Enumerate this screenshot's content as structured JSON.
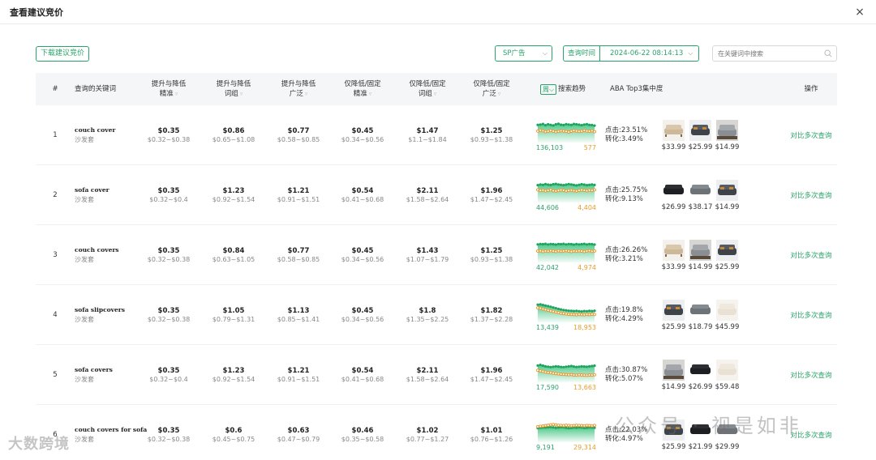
{
  "modal": {
    "title": "查看建议竞价",
    "close_glyph": "×"
  },
  "toolbar": {
    "download_label": "下载建议竞价",
    "ad_type": "SP广告",
    "query_time_label": "查询时间",
    "query_time_value": "2024-06-22 08:14:13",
    "search_placeholder": "在关键词中搜索"
  },
  "columns": {
    "index": "#",
    "keyword": "查询的关键词",
    "c1a": "提升与降低",
    "c1b": "精准",
    "c2a": "提升与降低",
    "c2b": "词组",
    "c3a": "提升与降低",
    "c3b": "广泛",
    "c4a": "仅降低/固定",
    "c4b": "精准",
    "c5a": "仅降低/固定",
    "c5b": "词组",
    "c6a": "仅降低/固定",
    "c6b": "广泛",
    "period": "周",
    "trend": "搜索趋势",
    "aba": "ABA Top3集中度",
    "action": "操作"
  },
  "rows": [
    {
      "idx": "1",
      "kw_en": "couch cover",
      "kw_cn": "沙发套",
      "bids": [
        [
          "$0.35",
          "$0.32~$0.38"
        ],
        [
          "$0.86",
          "$0.65~$1.08"
        ],
        [
          "$0.77",
          "$0.58~$0.85"
        ],
        [
          "$0.45",
          "$0.34~$0.56"
        ],
        [
          "$1.47",
          "$1.1~$1.84"
        ],
        [
          "$1.25",
          "$0.93~$1.38"
        ]
      ],
      "trend_left": "136,103",
      "trend_right": "577",
      "trend_green": [
        0.9,
        0.92,
        0.95,
        0.88,
        0.93,
        0.9,
        0.87,
        0.93,
        0.96,
        0.91,
        0.89,
        0.94,
        0.92,
        0.9,
        0.95,
        0.93,
        0.91,
        0.88,
        0.92,
        0.94,
        0.9,
        0.89,
        0.86
      ],
      "trend_orange": [
        0.55,
        0.6,
        0.57,
        0.52,
        0.54,
        0.58,
        0.55,
        0.51,
        0.53,
        0.57,
        0.56,
        0.53,
        0.5,
        0.54,
        0.58,
        0.56,
        0.53,
        0.55,
        0.59,
        0.56,
        0.54,
        0.57,
        0.52
      ],
      "click": "点击:23.51%",
      "conv": "转化:3.49%",
      "prices": [
        "$33.99",
        "$25.99",
        "$14.99"
      ],
      "thumbs": [
        "beige-sofa-icon",
        "dark-sofa-icon",
        "grey-sofa-icon"
      ],
      "action": "对比多次查询"
    },
    {
      "idx": "2",
      "kw_en": "sofa cover",
      "kw_cn": "沙发套",
      "bids": [
        [
          "$0.35",
          "$0.32~$0.4"
        ],
        [
          "$1.23",
          "$0.92~$1.54"
        ],
        [
          "$1.21",
          "$0.91~$1.51"
        ],
        [
          "$0.54",
          "$0.41~$0.68"
        ],
        [
          "$2.11",
          "$1.58~$2.64"
        ],
        [
          "$1.96",
          "$1.47~$2.45"
        ]
      ],
      "trend_left": "44,606",
      "trend_right": "4,404",
      "trend_green": [
        0.88,
        0.92,
        0.9,
        0.94,
        0.91,
        0.89,
        0.93,
        0.95,
        0.92,
        0.9,
        0.88,
        0.91,
        0.94,
        0.92,
        0.89,
        0.87,
        0.9,
        0.93,
        0.91,
        0.88,
        0.9,
        0.92,
        0.89
      ],
      "trend_orange": [
        0.62,
        0.58,
        0.6,
        0.56,
        0.59,
        0.62,
        0.57,
        0.55,
        0.58,
        0.61,
        0.59,
        0.56,
        0.58,
        0.6,
        0.57,
        0.55,
        0.58,
        0.61,
        0.59,
        0.57,
        0.6,
        0.58,
        0.62
      ],
      "click": "点击:25.75%",
      "conv": "转化:9.13%",
      "prices": [
        "$26.99",
        "$38.17",
        "$14.99"
      ],
      "thumbs": [
        "black-cover-icon",
        "grey-cover-icon",
        "dark-sofa-icon"
      ],
      "action": "对比多次查询"
    },
    {
      "idx": "3",
      "kw_en": "couch covers",
      "kw_cn": "沙发套",
      "bids": [
        [
          "$0.35",
          "$0.32~$0.38"
        ],
        [
          "$0.84",
          "$0.63~$1.05"
        ],
        [
          "$0.77",
          "$0.58~$0.85"
        ],
        [
          "$0.45",
          "$0.34~$0.56"
        ],
        [
          "$1.43",
          "$1.07~$1.79"
        ],
        [
          "$1.25",
          "$0.93~$1.38"
        ]
      ],
      "trend_left": "42,042",
      "trend_right": "4,974",
      "trend_green": [
        0.92,
        0.94,
        0.93,
        0.95,
        0.92,
        0.94,
        0.93,
        0.91,
        0.94,
        0.93,
        0.95,
        0.92,
        0.94,
        0.93,
        0.91,
        0.94,
        0.92,
        0.93,
        0.95,
        0.92,
        0.94,
        0.93,
        0.91
      ],
      "trend_orange": [
        0.54,
        0.56,
        0.52,
        0.55,
        0.53,
        0.57,
        0.54,
        0.52,
        0.56,
        0.53,
        0.55,
        0.57,
        0.54,
        0.52,
        0.55,
        0.53,
        0.56,
        0.54,
        0.52,
        0.55,
        0.57,
        0.53,
        0.55
      ],
      "click": "点击:26.26%",
      "conv": "转化:3.21%",
      "prices": [
        "$33.99",
        "$14.99",
        "$25.99"
      ],
      "thumbs": [
        "beige-sofa-icon",
        "grey-sofa-icon",
        "dark-sofa-icon"
      ],
      "action": "对比多次查询"
    },
    {
      "idx": "4",
      "kw_en": "sofa slipcovers",
      "kw_cn": "沙发套",
      "bids": [
        [
          "$0.35",
          "$0.32~$0.38"
        ],
        [
          "$1.05",
          "$0.79~$1.31"
        ],
        [
          "$1.13",
          "$0.85~$1.41"
        ],
        [
          "$0.45",
          "$0.34~$0.56"
        ],
        [
          "$1.8",
          "$1.35~$2.25"
        ],
        [
          "$1.82",
          "$1.37~$2.28"
        ]
      ],
      "trend_left": "13,439",
      "trend_right": "18,953",
      "trend_green": [
        0.9,
        0.92,
        0.88,
        0.85,
        0.82,
        0.78,
        0.74,
        0.7,
        0.66,
        0.63,
        0.6,
        0.58,
        0.56,
        0.55,
        0.54,
        0.55,
        0.53,
        0.52,
        0.54,
        0.53,
        0.55,
        0.54,
        0.56
      ],
      "trend_orange": [
        0.72,
        0.7,
        0.66,
        0.62,
        0.58,
        0.55,
        0.52,
        0.48,
        0.45,
        0.42,
        0.4,
        0.38,
        0.36,
        0.35,
        0.34,
        0.33,
        0.35,
        0.34,
        0.33,
        0.35,
        0.34,
        0.36,
        0.35
      ],
      "click": "点击:19.8%",
      "conv": "转化:4.29%",
      "prices": [
        "$25.99",
        "$18.79",
        "$45.99"
      ],
      "thumbs": [
        "dark-sofa-icon",
        "grey-cover-icon",
        "cream-sofa-icon"
      ],
      "action": "对比多次查询"
    },
    {
      "idx": "5",
      "kw_en": "sofa covers",
      "kw_cn": "沙发套",
      "bids": [
        [
          "$0.35",
          "$0.32~$0.4"
        ],
        [
          "$1.23",
          "$0.92~$1.54"
        ],
        [
          "$1.21",
          "$0.91~$1.51"
        ],
        [
          "$0.54",
          "$0.41~$0.68"
        ],
        [
          "$2.11",
          "$1.58~$2.64"
        ],
        [
          "$1.96",
          "$1.47~$2.45"
        ]
      ],
      "trend_left": "17,590",
      "trend_right": "13,663",
      "trend_green": [
        0.85,
        0.88,
        0.84,
        0.8,
        0.78,
        0.76,
        0.78,
        0.8,
        0.79,
        0.77,
        0.76,
        0.78,
        0.8,
        0.82,
        0.79,
        0.77,
        0.78,
        0.8,
        0.79,
        0.78,
        0.8,
        0.82,
        0.84
      ],
      "trend_orange": [
        0.58,
        0.55,
        0.52,
        0.48,
        0.46,
        0.44,
        0.42,
        0.4,
        0.38,
        0.36,
        0.35,
        0.34,
        0.33,
        0.34,
        0.32,
        0.31,
        0.33,
        0.32,
        0.31,
        0.3,
        0.32,
        0.31,
        0.33
      ],
      "click": "点击:30.87%",
      "conv": "转化:5.07%",
      "prices": [
        "$14.99",
        "$26.99",
        "$59.48"
      ],
      "thumbs": [
        "grey-sofa-icon",
        "black-cover-icon",
        "cream-sofa-icon"
      ],
      "action": "对比多次查询"
    },
    {
      "idx": "6",
      "kw_en": "couch covers for sofa",
      "kw_cn": "沙发套",
      "bids": [
        [
          "$0.35",
          "$0.32~$0.38"
        ],
        [
          "$0.6",
          "$0.45~$0.75"
        ],
        [
          "$0.63",
          "$0.47~$0.79"
        ],
        [
          "$0.46",
          "$0.35~$0.58"
        ],
        [
          "$1.02",
          "$0.77~$1.27"
        ],
        [
          "$1.01",
          "$0.76~$1.26"
        ]
      ],
      "trend_left": "9,191",
      "trend_right": "29,314",
      "trend_green": [
        0.7,
        0.72,
        0.74,
        0.73,
        0.75,
        0.76,
        0.74,
        0.72,
        0.73,
        0.75,
        0.74,
        0.72,
        0.7,
        0.71,
        0.73,
        0.72,
        0.74,
        0.73,
        0.71,
        0.72,
        0.74,
        0.73,
        0.72
      ],
      "trend_orange": [
        0.78,
        0.8,
        0.82,
        0.84,
        0.86,
        0.88,
        0.9,
        0.88,
        0.86,
        0.85,
        0.84,
        0.86,
        0.85,
        0.83,
        0.84,
        0.86,
        0.85,
        0.84,
        0.83,
        0.85,
        0.84,
        0.83,
        0.85
      ],
      "click": "点击:22.03%",
      "conv": "转化:4.97%",
      "prices": [
        "$25.99",
        "$21.99",
        "$29.99"
      ],
      "thumbs": [
        "dark-sofa-icon",
        "black-cover-icon",
        "grey-cover-icon"
      ],
      "action": "对比多次查询"
    }
  ],
  "watermarks": {
    "left": "大数跨境",
    "right": "公众号 · 视是如非"
  },
  "colors": {
    "accent": "#2aa36b",
    "trend_green": "#1fa35f",
    "trend_orange": "#e8962a"
  }
}
